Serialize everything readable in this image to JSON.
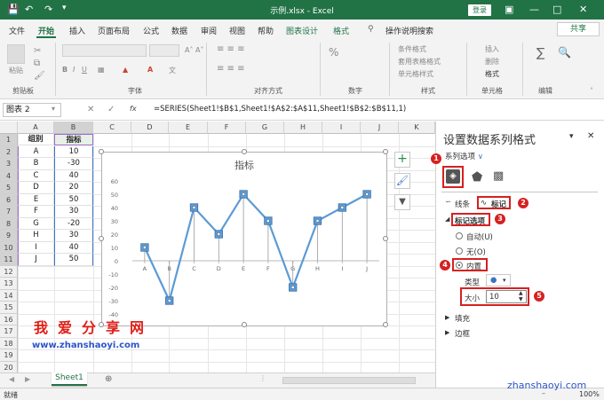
{
  "titlebar": {
    "title": "示例.xlsx  -  Excel",
    "login": "登录",
    "quick_access": [
      "save-icon",
      "undo-icon",
      "redo-icon",
      "customize-icon"
    ]
  },
  "tabs": [
    "文件",
    "开始",
    "插入",
    "页面布局",
    "公式",
    "数据",
    "审阅",
    "视图",
    "帮助",
    "图表设计",
    "格式"
  ],
  "active_tab": "开始",
  "tell_me": "操作说明搜索",
  "share": "共享",
  "ribbon": {
    "groups": [
      "剪贴板",
      "字体",
      "对齐方式",
      "数字",
      "样式",
      "单元格",
      "编辑"
    ],
    "paste": "粘贴",
    "styles": [
      "条件格式",
      "套用表格格式",
      "单元格样式"
    ],
    "cells": [
      "插入",
      "删除",
      "格式"
    ]
  },
  "formula_bar": {
    "name_box": "图表 2",
    "fx": "fx",
    "formula": "=SERIES(Sheet1!$B$1,Sheet1!$A$2:$A$11,Sheet1!$B$2:$B$11,1)"
  },
  "sheet": {
    "columns": [
      "A",
      "B",
      "C",
      "D",
      "E",
      "F",
      "G",
      "H",
      "I",
      "J",
      "K"
    ],
    "rows": [
      "1",
      "2",
      "3",
      "4",
      "5",
      "6",
      "7",
      "8",
      "9",
      "10",
      "11",
      "12",
      "13",
      "14",
      "15",
      "16",
      "17",
      "18",
      "19",
      "20"
    ],
    "header_a": "组别",
    "header_b": "指标",
    "data": [
      [
        "A",
        "10"
      ],
      [
        "B",
        "-30"
      ],
      [
        "C",
        "40"
      ],
      [
        "D",
        "20"
      ],
      [
        "E",
        "50"
      ],
      [
        "F",
        "30"
      ],
      [
        "G",
        "-20"
      ],
      [
        "H",
        "30"
      ],
      [
        "I",
        "40"
      ],
      [
        "J",
        "50"
      ]
    ]
  },
  "chart_data": {
    "type": "line",
    "title": "指标",
    "categories": [
      "A",
      "B",
      "C",
      "D",
      "E",
      "F",
      "G",
      "H",
      "I",
      "J"
    ],
    "series": [
      {
        "name": "指标",
        "values": [
          10,
          -30,
          40,
          20,
          50,
          30,
          -20,
          30,
          40,
          50
        ]
      }
    ],
    "ylim": [
      -40,
      60
    ],
    "yticks": [
      60,
      50,
      40,
      30,
      20,
      10,
      0,
      -10,
      -20,
      -30,
      -40
    ],
    "marker": "built-in square",
    "marker_size": 10,
    "line_color": "#5b9bd5",
    "drop_lines": true
  },
  "watermark": {
    "cn": "我爱分享网",
    "url": "www.zhanshaoyi.com",
    "corner": "zhanshaoyi.com"
  },
  "sheet_tabs": {
    "tab": "Sheet1"
  },
  "status": {
    "ready": "就绪",
    "zoom": "100%"
  },
  "pane": {
    "title": "设置数据系列格式",
    "series_options": "系列选项",
    "line_tab": "线条",
    "marker_tab": "标记",
    "marker_options": "标记选项",
    "auto": "自动(U)",
    "none": "无(O)",
    "builtin": "内置",
    "type_label": "类型",
    "size_label": "大小",
    "size_value": "10",
    "fill": "填充",
    "border": "边框",
    "annotations": [
      "1",
      "2",
      "3",
      "4",
      "5"
    ]
  }
}
